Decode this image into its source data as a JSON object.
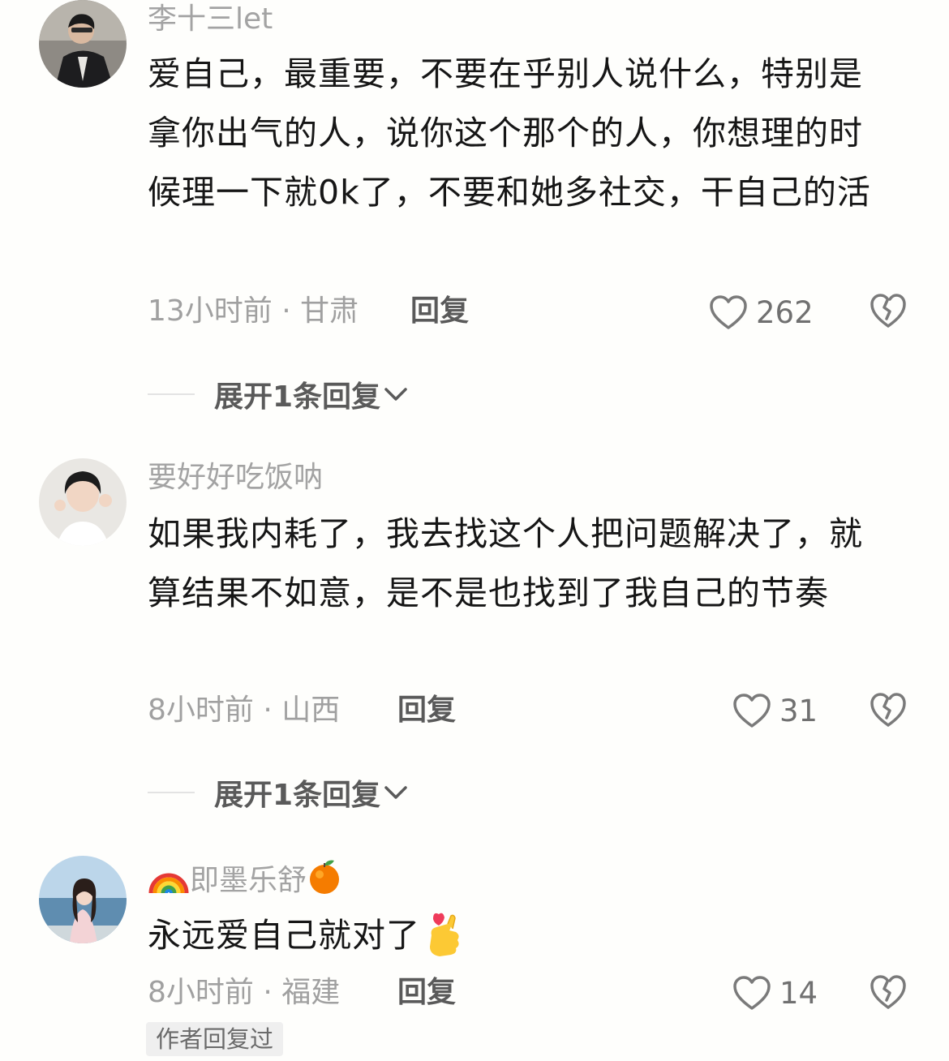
{
  "comments": [
    {
      "username": "李十三let",
      "text": "爱自己，最重要，不要在乎别人说什么，特别是拿你出气的人，说你这个那个的人，你想理的时候理一下就0k了，不要和她多社交，干自己的活",
      "meta": "13小时前 · 甘肃",
      "reply_label": "回复",
      "likes": "262",
      "expand_label": "展开1条回复"
    },
    {
      "username": "要好好吃饭呐",
      "text": "如果我内耗了，我去找这个人把问题解决了，就算结果不如意，是不是也找到了我自己的节奏",
      "meta": "8小时前 · 山西",
      "reply_label": "回复",
      "likes": "31",
      "expand_label": "展开1条回复"
    },
    {
      "username": "即墨乐舒",
      "username_prefix_icon": "rainbow-emoji",
      "username_suffix_icon": "tangerine-emoji",
      "text": "永远爱自己就对了",
      "text_suffix_icon": "finger-heart-emoji",
      "meta": "8小时前 · 福建",
      "reply_label": "回复",
      "likes": "14",
      "badge": "作者回复过"
    }
  ],
  "colors": {
    "background": "#fefefc",
    "text": "#161616",
    "secondary": "#a0a0a0",
    "action": "#5a5a5a"
  }
}
